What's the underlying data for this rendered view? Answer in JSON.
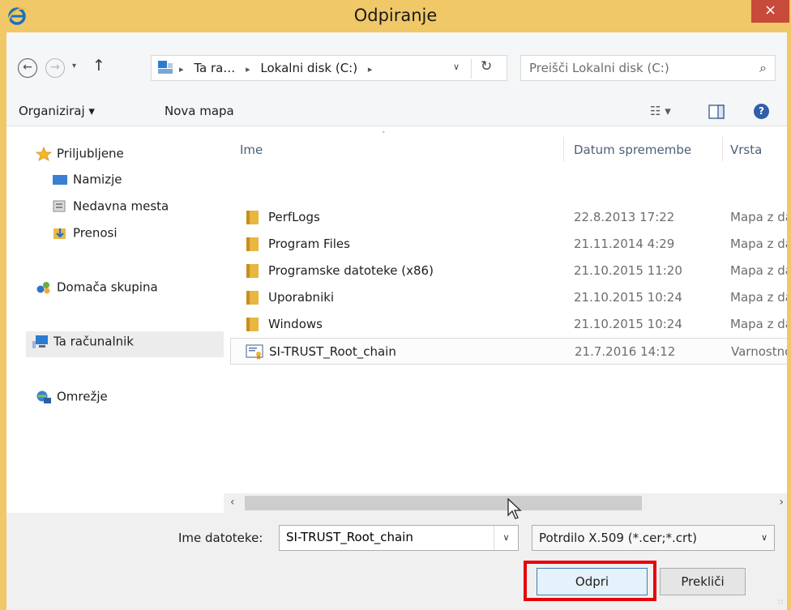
{
  "window": {
    "title": "Odpiranje",
    "close_glyph": "×"
  },
  "nav": {
    "back": "←",
    "forward": "→",
    "recent_dropdown": "▾",
    "up": "↑"
  },
  "address": {
    "crumbs": [
      "Ta ra…",
      "Lokalni disk (C:)"
    ],
    "separator": "▸",
    "dropdown": "∨",
    "refresh": "↻"
  },
  "search": {
    "placeholder": "Preišči Lokalni disk (C:)",
    "icon": "⌕"
  },
  "toolbar": {
    "organize": "Organiziraj ▾",
    "new_folder": "Nova mapa",
    "view_icon": "☷ ▾",
    "help_icon": "?"
  },
  "sidebar": {
    "favorites": "Priljubljene",
    "desktop": "Namizje",
    "recent": "Nedavna mesta",
    "downloads": "Prenosi",
    "homegroup": "Domača skupina",
    "this_pc": "Ta računalnik",
    "network": "Omrežje"
  },
  "columns": {
    "name": "Ime",
    "date": "Datum spremembe",
    "type": "Vrsta",
    "sort_arrow": "˄"
  },
  "files": [
    {
      "name": "PerfLogs",
      "date": "22.8.2013 17:22",
      "type": "Mapa z da",
      "kind": "folder"
    },
    {
      "name": "Program Files",
      "date": "21.11.2014 4:29",
      "type": "Mapa z da",
      "kind": "folder"
    },
    {
      "name": "Programske datoteke (x86)",
      "date": "21.10.2015 11:20",
      "type": "Mapa z da",
      "kind": "folder"
    },
    {
      "name": "Uporabniki",
      "date": "21.10.2015 10:24",
      "type": "Mapa z da",
      "kind": "folder"
    },
    {
      "name": "Windows",
      "date": "21.10.2015 10:24",
      "type": "Mapa z da",
      "kind": "folder"
    },
    {
      "name": "SI-TRUST_Root_chain",
      "date": "21.7.2016 14:12",
      "type": "Varnostno",
      "kind": "certificate"
    }
  ],
  "scrollbar": {
    "left": "‹",
    "right": "›"
  },
  "bottom": {
    "filename_label": "Ime datoteke:",
    "filename_value": "SI-TRUST_Root_chain",
    "filename_dropdown": "∨",
    "file_type": "Potrdilo X.509 (*.cer;*.crt)",
    "file_type_dropdown": "∨",
    "open_button": "Odpri",
    "cancel_button": "Prekliči",
    "grip": "∷"
  },
  "colors": {
    "titlebar": "#f0c868",
    "close": "#c74a3a",
    "highlight": "#e8000b",
    "folder": "#e9b63f"
  }
}
